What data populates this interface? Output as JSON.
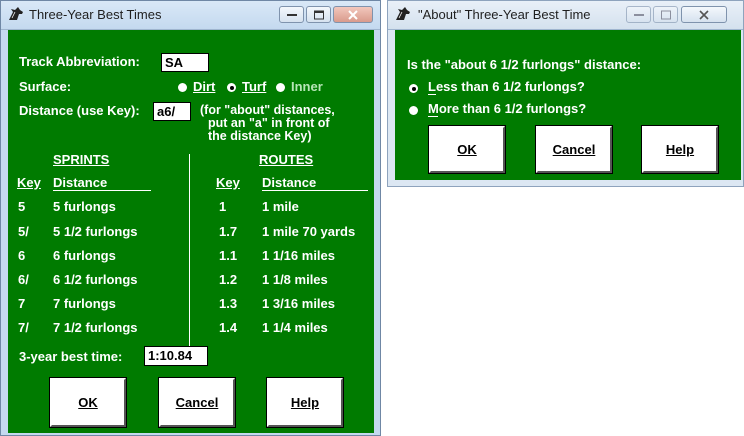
{
  "main_window": {
    "title": "Three-Year Best Times",
    "track_label": "Track Abbreviation:",
    "track_value": "SA",
    "surface_label": "Surface:",
    "surface_options": [
      {
        "label": "Dirt",
        "selected": false
      },
      {
        "label": "Turf",
        "selected": true
      },
      {
        "label": "Inner",
        "selected": false,
        "disabled": true
      }
    ],
    "distance_label": "Distance (use Key):",
    "distance_value": "a6/",
    "distance_note": [
      "(for \"about\" distances,",
      "put an \"a\" in front of",
      "the distance Key)"
    ],
    "sprints_header": "SPRINTS",
    "routes_header": "ROUTES",
    "key_header": "Key",
    "distance_header": "Distance",
    "sprints": [
      {
        "key": "5",
        "distance": "5 furlongs"
      },
      {
        "key": "5/",
        "distance": "5 1/2 furlongs"
      },
      {
        "key": "6",
        "distance": "6 furlongs"
      },
      {
        "key": "6/",
        "distance": "6 1/2 furlongs"
      },
      {
        "key": "7",
        "distance": "7 furlongs"
      },
      {
        "key": "7/",
        "distance": "7 1/2 furlongs"
      }
    ],
    "routes": [
      {
        "key": "1",
        "distance": "1 mile"
      },
      {
        "key": "1.7",
        "distance": "1 mile 70 yards"
      },
      {
        "key": "1.1",
        "distance": "1 1/16 miles"
      },
      {
        "key": "1.2",
        "distance": "1 1/8 miles"
      },
      {
        "key": "1.3",
        "distance": "1 3/16 miles"
      },
      {
        "key": "1.4",
        "distance": "1 1/4 miles"
      }
    ],
    "best_time_label": "3-year best time:",
    "best_time_value": "1:10.84",
    "buttons": {
      "ok": "OK",
      "cancel": "Cancel",
      "help": "Help"
    }
  },
  "about_window": {
    "title": "\"About\" Three-Year Best Time",
    "question": "Is the \"about 6 1/2 furlongs\" distance:",
    "options": [
      {
        "label": "Less than 6 1/2 furlongs?",
        "selected": true
      },
      {
        "label": "More than 6 1/2 furlongs?",
        "selected": false
      }
    ],
    "buttons": {
      "ok": "OK",
      "cancel": "Cancel",
      "help": "Help"
    }
  },
  "colors": {
    "dialog_bg": "#007b00",
    "text": "#ffffff",
    "disabled_text": "#b6e6b6",
    "titlebar": "#c4d9ef"
  },
  "icons": {
    "app": "horse-head-icon",
    "minimize": "minimize-icon",
    "maximize": "maximize-icon",
    "close": "close-icon"
  }
}
